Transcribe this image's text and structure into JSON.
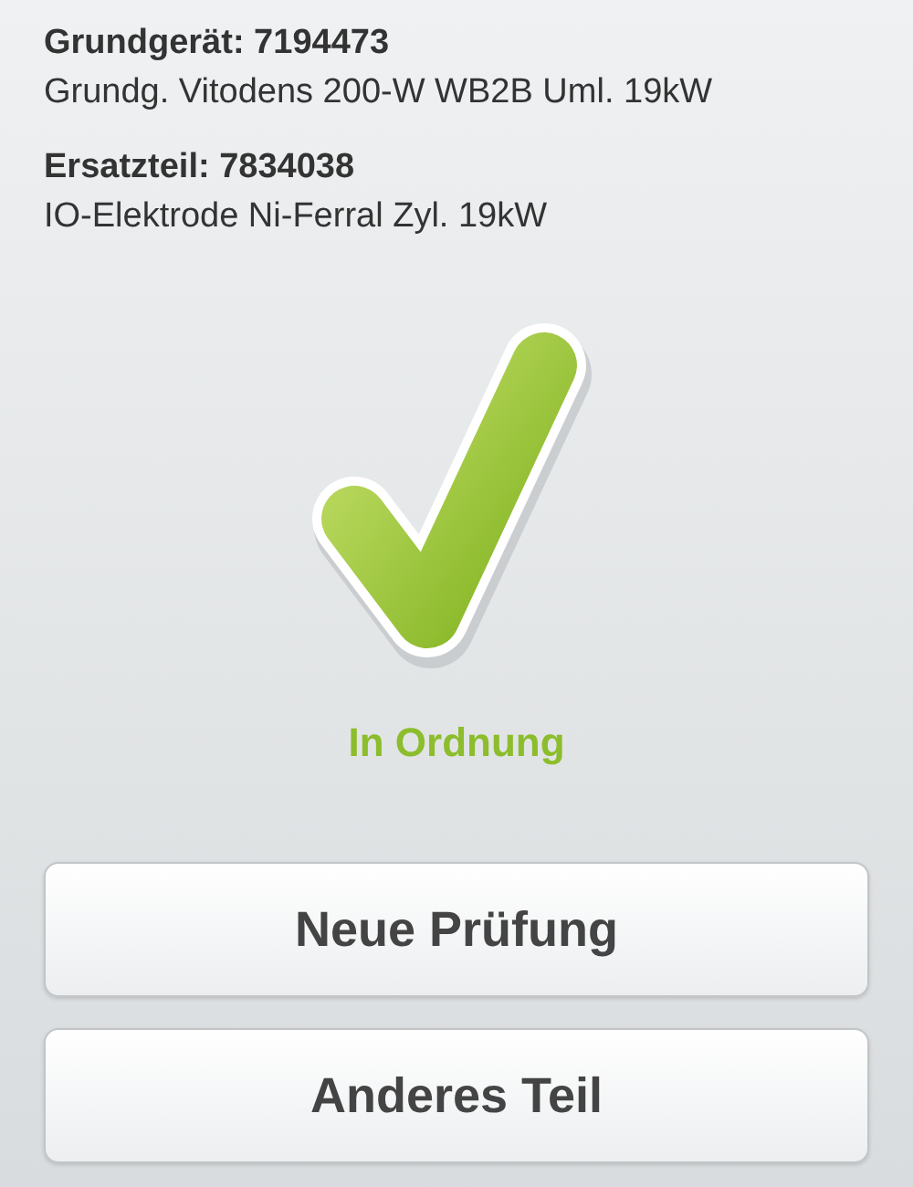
{
  "items": [
    {
      "label": "Grundgerät: 7194473",
      "description": "Grundg. Vitodens 200-W WB2B Uml. 19kW"
    },
    {
      "label": "Ersatzteil: 7834038",
      "description": "IO-Elektrode Ni-Ferral Zyl. 19kW"
    }
  ],
  "status": {
    "kind": "ok",
    "text": "In Ordnung"
  },
  "buttons": [
    "Neue Prüfung",
    "Anderes Teil"
  ]
}
